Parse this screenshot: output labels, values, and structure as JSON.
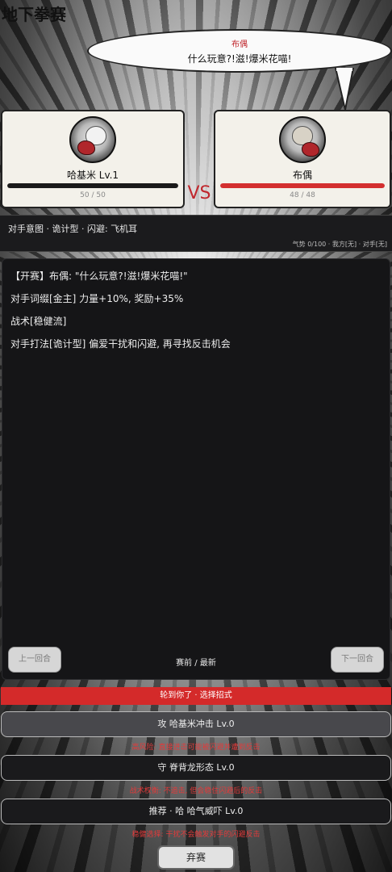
{
  "game": {
    "title": "地下拳赛"
  },
  "speech": {
    "speaker": "布偶",
    "text": "什么玩意?!滋!爆米花喵!"
  },
  "player": {
    "name_level": "哈基米 Lv.1",
    "hp": 50,
    "max_hp": 50,
    "hp_text": "50 / 50",
    "bar_color": "#1a1a1a"
  },
  "opponent": {
    "name": "布偶",
    "hp": 48,
    "max_hp": 48,
    "hp_text": "48 / 48",
    "bar_color": "#d32f2f"
  },
  "vs_label": "VS",
  "intent": {
    "text": "对手意图 · 诡计型 · 闪避: 飞机耳",
    "momentum": "气势 0/100 · 我方[无] · 对手[无]"
  },
  "log": [
    "【开赛】布偶: \"什么玩意?!滋!爆米花喵!\"",
    "对手词缀[金主] 力量+10%, 奖励+35%",
    "战术[稳健流]",
    "对手打法[诡计型] 偏爱干扰和闪避, 再寻找反击机会"
  ],
  "nav": {
    "prev": "上一回合",
    "next": "下一回合",
    "status": "赛前 / 最新"
  },
  "turn_banner": "轮到你了 · 选择招式",
  "moves": [
    {
      "label": "攻 哈基米冲击 Lv.0",
      "desc": "高风险: 直接进击可能被闪避并遭到反击"
    },
    {
      "label": "守 脊背龙形态 Lv.0",
      "desc": "战术权衡: 不追击, 但会稳住闪避后的反击"
    },
    {
      "label": "推荐 · 哈 哈气威吓 Lv.0",
      "desc": "稳健选择: 干扰不会触发对手的闪避反击"
    }
  ],
  "forfeit": "弃赛",
  "colors": {
    "accent_red": "#d42a2a",
    "panel_dark": "#151517"
  }
}
